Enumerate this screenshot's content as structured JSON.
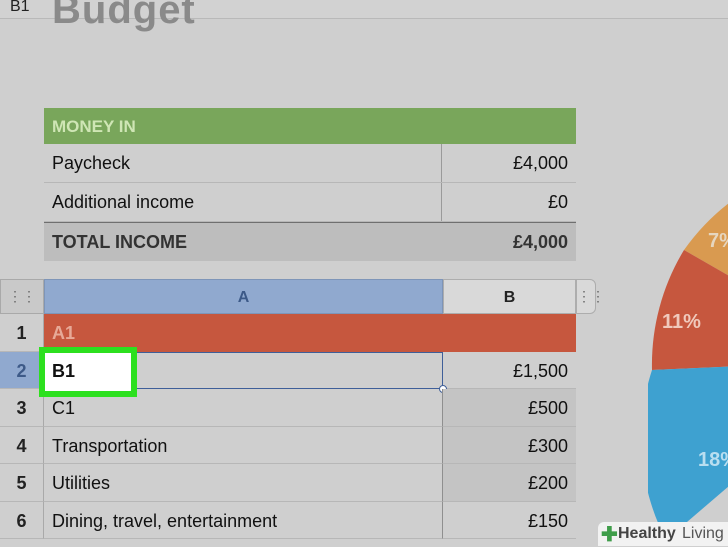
{
  "toolbar": {
    "cell_ref": "B1"
  },
  "sheet": {
    "title": "Budget"
  },
  "money_in": {
    "header": "MONEY IN",
    "rows": [
      {
        "label": "Paycheck",
        "value": "£4,000"
      },
      {
        "label": "Additional income",
        "value": "£0"
      }
    ],
    "total": {
      "label": "TOTAL INCOME",
      "value": "£4,000"
    }
  },
  "grid": {
    "corner_icon": "drag-grip-icon",
    "columns": [
      "A",
      "B"
    ],
    "rows": [
      {
        "num": "1",
        "a": "A1",
        "b": ""
      },
      {
        "num": "2",
        "a": "",
        "b": "£1,500"
      },
      {
        "num": "3",
        "a": "C1",
        "b": "£500"
      },
      {
        "num": "4",
        "a": "Transportation",
        "b": "£300"
      },
      {
        "num": "5",
        "a": "Utilities",
        "b": "£200"
      },
      {
        "num": "6",
        "a": "Dining, travel, entertainment",
        "b": "£150"
      }
    ],
    "editor_value": "B1"
  },
  "pie": {
    "labels": [
      "7%",
      "11%",
      "18%"
    ]
  },
  "watermark": {
    "part1": "Healthy",
    "part2": "Living"
  },
  "colors": {
    "green": "#79a65b",
    "red": "#c6573e",
    "blue": "#90a9cf",
    "highlight": "#2de01f"
  }
}
